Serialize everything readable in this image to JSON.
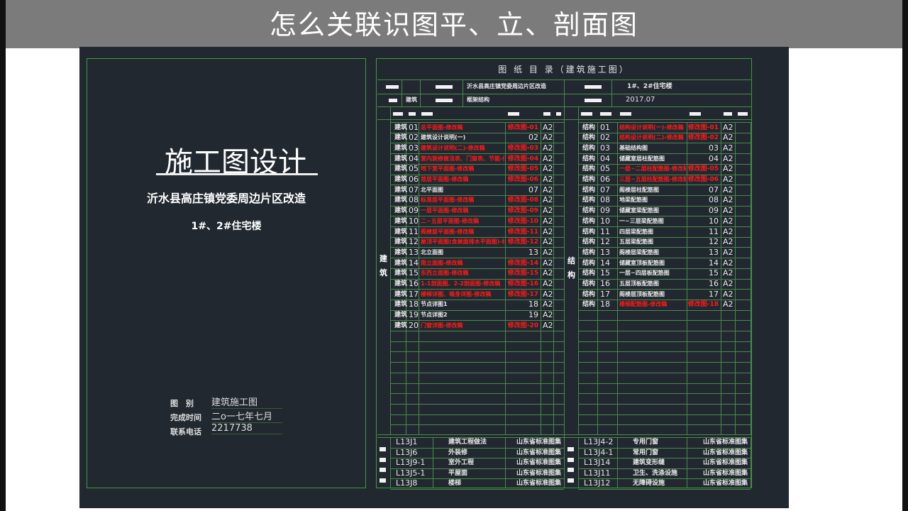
{
  "banner": {
    "title": "怎么关联识图平、立、剖面图"
  },
  "cover": {
    "title": "施工图设计",
    "project": "沂水县高庄镇党委周边片区改造",
    "building": "1#、2#住宅楼",
    "info": [
      {
        "label": "图　别",
        "value": "建筑施工图"
      },
      {
        "label": "完成时间",
        "value": "二o一七年七月"
      },
      {
        "label": "联系电话",
        "value": "2217738"
      }
    ]
  },
  "catalog": {
    "title": "图 纸 目 录（建筑施工图）",
    "project": "沂水县高庄镇党委周边片区改造",
    "building": "1#、2#住宅楼",
    "spec": "建筑",
    "structure": "框架结构",
    "date": "2017.07",
    "left_label": "建筑",
    "right_label": "结构",
    "left_rows": [
      [
        "建筑",
        "01",
        "总平面图-修改稿",
        "修改图-01",
        "A2",
        1
      ],
      [
        "建筑",
        "02",
        "建筑设计说明(一)",
        "02",
        "A2",
        0
      ],
      [
        "建筑",
        "03",
        "建筑设计说明(二)-修改稿",
        "修改图-03",
        "A2",
        1
      ],
      [
        "建筑",
        "04",
        "室内装修做法表、门窗表、节能-修改稿",
        "修改图-04",
        "A2",
        1
      ],
      [
        "建筑",
        "05",
        "地下室平面图-修改稿",
        "修改图-05",
        "A2",
        1
      ],
      [
        "建筑",
        "06",
        "首层平面图-修改稿",
        "修改图-06",
        "A2",
        1
      ],
      [
        "建筑",
        "07",
        "北平面图",
        "07",
        "A2",
        0
      ],
      [
        "建筑",
        "08",
        "标准层平面图-修改稿",
        "修改图-08",
        "A2",
        1
      ],
      [
        "建筑",
        "09",
        "一层平面图-修改稿",
        "修改图-09",
        "A2",
        1
      ],
      [
        "建筑",
        "10",
        "二~五层平面图-修改稿",
        "修改图-10",
        "A2",
        1
      ],
      [
        "建筑",
        "11",
        "阁楼层平面图-修改稿",
        "修改图-11",
        "A2",
        1
      ],
      [
        "建筑",
        "12",
        "屋顶平面图(含屋面排水平面图)-修改稿",
        "修改图-12",
        "A2",
        1
      ],
      [
        "建筑",
        "13",
        "北立面图",
        "13",
        "A2",
        0
      ],
      [
        "建筑",
        "14",
        "南立面图-修改稿",
        "修改图-14",
        "A2",
        1
      ],
      [
        "建筑",
        "15",
        "东西立面图-修改稿",
        "修改图-15",
        "A2",
        1
      ],
      [
        "建筑",
        "16",
        "1-1剖面图、2-2剖面图-修改稿",
        "修改图-16",
        "A2",
        1
      ],
      [
        "建筑",
        "17",
        "楼梯详图、墙身详图-修改稿",
        "修改图-17",
        "A2",
        1
      ],
      [
        "建筑",
        "18",
        "节点详图1",
        "18",
        "A2",
        0
      ],
      [
        "建筑",
        "19",
        "节点详图2",
        "19",
        "A2",
        0
      ],
      [
        "建筑",
        "20",
        "门窗详图-修改稿",
        "修改图-20",
        "A2",
        1
      ]
    ],
    "right_rows": [
      [
        "结构",
        "01",
        "结构设计说明(一)-修改稿",
        "修改图-01",
        "A2",
        1
      ],
      [
        "结构",
        "02",
        "结构设计说明(二)-修改稿",
        "修改图-02",
        "A2",
        1
      ],
      [
        "结构",
        "03",
        "基础结构图",
        "03",
        "A2",
        0
      ],
      [
        "结构",
        "04",
        "储藏室层柱配筋图",
        "04",
        "A2",
        0
      ],
      [
        "结构",
        "05",
        "一层~二层柱配筋图-修改稿",
        "修改图-05",
        "A2",
        1
      ],
      [
        "结构",
        "06",
        "三层~五层柱配筋图-修改稿",
        "修改图-06",
        "A2",
        1
      ],
      [
        "结构",
        "07",
        "阁楼层柱配筋图",
        "07",
        "A2",
        0
      ],
      [
        "结构",
        "08",
        "地梁配筋图",
        "08",
        "A2",
        0
      ],
      [
        "结构",
        "09",
        "储藏室梁配筋图",
        "09",
        "A2",
        0
      ],
      [
        "结构",
        "10",
        "一~三层梁配筋图",
        "10",
        "A2",
        0
      ],
      [
        "结构",
        "11",
        "四层梁配筋图",
        "11",
        "A2",
        0
      ],
      [
        "结构",
        "12",
        "五层梁配筋图",
        "12",
        "A2",
        0
      ],
      [
        "结构",
        "13",
        "阁楼层梁配筋图",
        "13",
        "A2",
        0
      ],
      [
        "结构",
        "14",
        "储藏室顶板配筋图",
        "14",
        "A2",
        0
      ],
      [
        "结构",
        "15",
        "一层~四层板配筋图",
        "15",
        "A2",
        0
      ],
      [
        "结构",
        "16",
        "五层顶板配筋图",
        "16",
        "A2",
        0
      ],
      [
        "结构",
        "17",
        "阁楼层顶板配筋图",
        "17",
        "A2",
        0
      ],
      [
        "结构",
        "18",
        "楼梯配筋图-修改稿",
        "修改图-18",
        "A2",
        1
      ]
    ],
    "left_std": [
      [
        "L13J1",
        "建筑工程做法",
        "山东省标准图集"
      ],
      [
        "L13J6",
        "外装修",
        "山东省标准图集"
      ],
      [
        "L13J9-1",
        "室外工程",
        "山东省标准图集"
      ],
      [
        "L13J5-1",
        "平屋面",
        "山东省标准图集"
      ],
      [
        "L13J8",
        "楼梯",
        "山东省标准图集"
      ]
    ],
    "right_std": [
      [
        "L13J4-2",
        "专用门窗",
        "山东省标准图集"
      ],
      [
        "L13J4-1",
        "常用门窗",
        "山东省标准图集"
      ],
      [
        "L13J14",
        "建筑变形缝",
        "山东省标准图集"
      ],
      [
        "L13J11",
        "卫生、洗涤设施",
        "山东省标准图集"
      ],
      [
        "L13J12",
        "无障碍设施",
        "山东省标准图集"
      ]
    ]
  },
  "colors": {
    "frame": "#3f9a3f",
    "cad_bg": "#212830",
    "revised": "#ff1a1a"
  }
}
